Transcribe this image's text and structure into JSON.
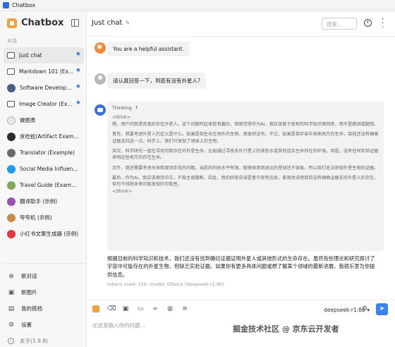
{
  "window": {
    "title": "Chatbox"
  },
  "sidebar": {
    "brand": "Chatbox",
    "section_label": "对话",
    "conversations": [
      {
        "label": "Just chat",
        "icon": "chat-bubble-icon",
        "starred": true,
        "active": true
      },
      {
        "label": "Markdown 101 (Ex...",
        "icon": "chat-bubble-icon",
        "starred": true
      },
      {
        "label": "Software Develop...",
        "icon": "developer-avatar-icon",
        "starred": true
      },
      {
        "label": "Image Creator (Ex...",
        "icon": "chat-bubble-icon",
        "starred": true
      },
      {
        "label": "做图表",
        "icon": "chart-avatar-icon"
      },
      {
        "label": "贪吃蛇(Artifact Example)",
        "icon": "snake-avatar-icon"
      },
      {
        "label": "Translator (Example)",
        "icon": "translator-avatar-icon"
      },
      {
        "label": "Social Media Influencer ...",
        "icon": "twitter-avatar-icon"
      },
      {
        "label": "Travel Guide (Example)",
        "icon": "travel-avatar-icon"
      },
      {
        "label": "翻译助手 (示例)",
        "icon": "translate-avatar-icon"
      },
      {
        "label": "夸夸机 (示例)",
        "icon": "praise-avatar-icon"
      },
      {
        "label": "小红书文案生成器 (示例)",
        "icon": "xiaohongshu-avatar-icon"
      }
    ],
    "bottom": [
      {
        "label": "新对话",
        "icon": "plus-circle-icon"
      },
      {
        "label": "新图片",
        "icon": "image-icon"
      },
      {
        "label": "我的搭档",
        "icon": "partner-icon"
      },
      {
        "label": "设置",
        "icon": "gear-icon"
      }
    ],
    "version": "关于(1.9.8)"
  },
  "header": {
    "title": "Just chat",
    "search_placeholder": "搜索..."
  },
  "messages": {
    "system": "You are a helpful assistant.",
    "user": "请认真回答一下，到底有没有外星人?",
    "thinking_label": "Thinking",
    "thinking": [
      "<think>",
      "嗯，用户问我是否真的存在外星人。这个问题听起来挺有趣的，但我觉得作为AI，我应该基于现有的科学知识来回答，而不是猜测或臆想。",
      "首先，我要考虑外星人的定义是什么。如果是指生长在地外的生物，那显然没有。不过，如果是指宇宙中其他地方的生命，目前还没有确凿证据支持这一点。科学上，我们只发现了地球上的生物。",
      "其次，科学研究一直在寻找可能存在的外星生命，比如通过寻找系外行星上的液态水或其他适合生命存在的环境。但是，没有任何实验证据表明这些地方的存在生命。",
      "另外，我还需要考虑天体和观测手段的问题。当前的科技水平有限，能够探测到遥远的星球还不容易，所以我们无法获取外星生物的证据。",
      "最后，作为AI，我应该保持中立，不做主观臆断。因此，我的回答应该是基于现有信息，客观地说明目前没有确凿证据支持外星人的存在，但也不排除未来可能发现的可能性。",
      "</think>"
    ],
    "answer": "根据目前的科学知识和技术，我们还没有找到确切证据证明外星人或其他形式的生命存在。虽然有些理论和研究探讨了宇宙中可能存在的外星生物，但缺乏实验证据。如果你有更多具体问题或想了解某个领域的最新进展，我很乐意为你提供信息。",
    "tokens": "tokens used: 159, model: Ollama (deepseek-r1:8b)"
  },
  "composer": {
    "model": "deepseek-r1:8b",
    "placeholder": "在这里输入你的问题..."
  },
  "watermark": "掘金技术社区 @ 京东云开发者"
}
